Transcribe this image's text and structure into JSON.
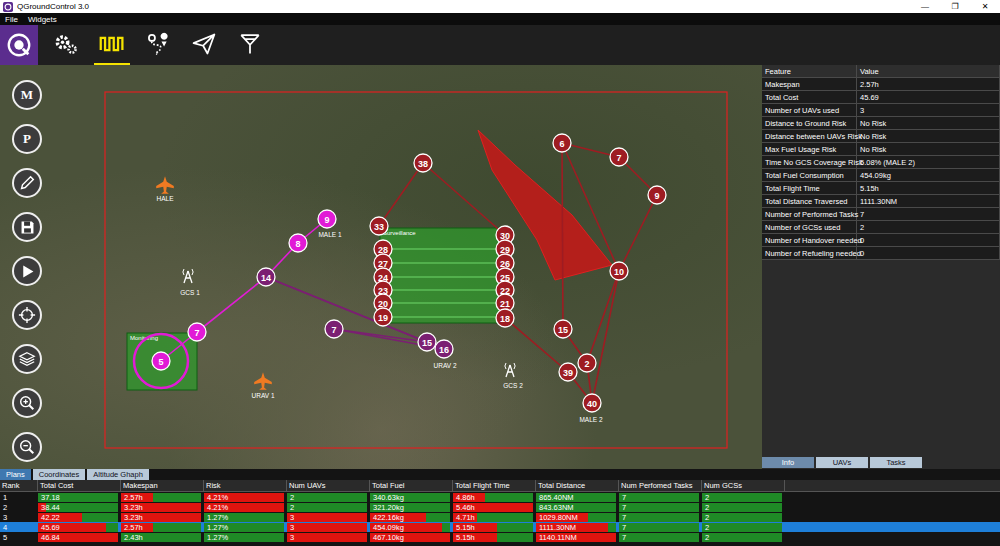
{
  "window": {
    "title": "QGroundControl 3.0",
    "controls": [
      "—",
      "❐",
      "✕"
    ]
  },
  "menu": [
    "File",
    "Widgets"
  ],
  "toolbar": {
    "tools": [
      {
        "kind": "settings",
        "selected": false
      },
      {
        "kind": "analyze",
        "selected": true
      },
      {
        "kind": "plan",
        "selected": false
      },
      {
        "kind": "fly",
        "selected": false
      },
      {
        "kind": "antenna",
        "selected": false
      }
    ]
  },
  "map_buttons": [
    {
      "kind": "letter",
      "label": "M"
    },
    {
      "kind": "letter",
      "label": "P"
    },
    {
      "kind": "edit",
      "label": ""
    },
    {
      "kind": "save",
      "label": ""
    },
    {
      "kind": "play",
      "label": ""
    },
    {
      "kind": "target",
      "label": ""
    },
    {
      "kind": "layers",
      "label": ""
    },
    {
      "kind": "zoom-in",
      "label": ""
    },
    {
      "kind": "zoom-out",
      "label": ""
    }
  ],
  "map": {
    "nodes": [
      {
        "label": "38",
        "color": "#9e1c22"
      },
      {
        "label": "33",
        "color": "#9e1c22"
      },
      {
        "label": "28",
        "color": "#9e1c22"
      },
      {
        "label": "27",
        "color": "#9e1c22"
      },
      {
        "label": "24",
        "color": "#9e1c22"
      },
      {
        "label": "23",
        "color": "#9e1c22"
      },
      {
        "label": "20",
        "color": "#9e1c22"
      },
      {
        "label": "19",
        "color": "#9e1c22"
      },
      {
        "label": "30",
        "color": "#9e1c22"
      },
      {
        "label": "29",
        "color": "#9e1c22"
      },
      {
        "label": "26",
        "color": "#9e1c22"
      },
      {
        "label": "25",
        "color": "#9e1c22"
      },
      {
        "label": "22",
        "color": "#9e1c22"
      },
      {
        "label": "21",
        "color": "#9e1c22"
      },
      {
        "label": "18",
        "color": "#9e1c22"
      },
      {
        "label": "6",
        "color": "#9e1c22"
      },
      {
        "label": "7",
        "color": "#9e1c22"
      },
      {
        "label": "9",
        "color": "#9e1c22"
      },
      {
        "label": "10",
        "color": "#9e1c22"
      },
      {
        "label": "15",
        "color": "#9e1c22"
      },
      {
        "label": "2",
        "color": "#9e1c22"
      },
      {
        "label": "39",
        "color": "#9e1c22"
      },
      {
        "label": "40",
        "color": "#9e1c22"
      },
      {
        "label": "9",
        "color": "#e11bd6"
      },
      {
        "label": "8",
        "color": "#e11bd6"
      },
      {
        "label": "14",
        "color": "#7b1f72"
      },
      {
        "label": "7",
        "color": "#e11bd6"
      },
      {
        "label": "5",
        "color": "#e11bd6"
      },
      {
        "label": "7",
        "color": "#7b1f72"
      },
      {
        "label": "15",
        "color": "#7b1f72"
      },
      {
        "label": "16",
        "color": "#7b1f72"
      }
    ],
    "markers": [
      {
        "label": "HALE",
        "kind": "plane"
      },
      {
        "label": "GCS 1",
        "kind": "antenna"
      },
      {
        "label": "URAV 1",
        "kind": "plane"
      },
      {
        "label": "GCS 2",
        "kind": "antenna"
      },
      {
        "label": "MALE 1",
        "kind": "tag"
      },
      {
        "label": "URAV 2",
        "kind": "tag"
      },
      {
        "label": "MALE 2",
        "kind": "tag"
      }
    ],
    "areas": [
      {
        "label": "Surveillance"
      },
      {
        "label": "Monitoring"
      }
    ]
  },
  "info": {
    "columns": [
      "Feature",
      "Value"
    ],
    "rows": [
      {
        "feature": "Makespan",
        "value": "2.57h"
      },
      {
        "feature": "Total Cost",
        "value": "45.69"
      },
      {
        "feature": "Number of UAVs used",
        "value": "3"
      },
      {
        "feature": "Distance to Ground Risk",
        "value": "No Risk"
      },
      {
        "feature": "Distance between UAVs Risk",
        "value": "No Risk"
      },
      {
        "feature": "Max Fuel Usage Risk",
        "value": "No Risk"
      },
      {
        "feature": "Time No GCS Coverage Risk",
        "value": "5.08% (MALE 2)"
      },
      {
        "feature": "Total Fuel Consumption",
        "value": "454.09kg"
      },
      {
        "feature": "Total Flight Time",
        "value": "5.15h"
      },
      {
        "feature": "Total Distance Traversed",
        "value": "1111.30NM"
      },
      {
        "feature": "Number of Performed Tasks",
        "value": "7"
      },
      {
        "feature": "Number of GCSs used",
        "value": "2"
      },
      {
        "feature": "Number of Handover needed",
        "value": "0"
      },
      {
        "feature": "Number of Refueling needed",
        "value": "0"
      }
    ],
    "tabs": [
      {
        "label": "Info",
        "selected": true
      },
      {
        "label": "UAVs",
        "selected": false
      },
      {
        "label": "Tasks",
        "selected": false
      }
    ]
  },
  "plans": {
    "tabs": [
      {
        "label": "Plans",
        "selected": true
      },
      {
        "label": "Coordinates",
        "selected": false
      },
      {
        "label": "Altitude Ghaph",
        "selected": false
      }
    ],
    "columns": [
      "Rank",
      "Total Cost",
      "Makespan",
      "Risk",
      "Num UAVs",
      "Total Fuel",
      "Total Flight Time",
      "Total Distance",
      "Num Perfomed Tasks",
      "Num GCSs"
    ],
    "rows": [
      {
        "rank": "1",
        "selected": false,
        "cells": [
          {
            "text": "37.18",
            "level": 0
          },
          {
            "text": "2.57h",
            "level": 0.4
          },
          {
            "text": "4.21%",
            "level": 1
          },
          {
            "text": "2",
            "level": 0
          },
          {
            "text": "340.63kg",
            "level": 0
          },
          {
            "text": "4.86h",
            "level": 0.4
          },
          {
            "text": "865.40NM",
            "level": 0
          },
          {
            "text": "7",
            "level": 0
          },
          {
            "text": "2",
            "level": 0
          }
        ]
      },
      {
        "rank": "2",
        "selected": false,
        "cells": [
          {
            "text": "38.44",
            "level": 0.1
          },
          {
            "text": "3.23h",
            "level": 1
          },
          {
            "text": "4.21%",
            "level": 1
          },
          {
            "text": "2",
            "level": 0
          },
          {
            "text": "321.20kg",
            "level": 0
          },
          {
            "text": "5.46h",
            "level": 1
          },
          {
            "text": "843.63NM",
            "level": 0
          },
          {
            "text": "7",
            "level": 0
          },
          {
            "text": "2",
            "level": 0
          }
        ]
      },
      {
        "rank": "3",
        "selected": false,
        "cells": [
          {
            "text": "42.22",
            "level": 0.55
          },
          {
            "text": "3.23h",
            "level": 1
          },
          {
            "text": "1.27%",
            "level": 0
          },
          {
            "text": "3",
            "level": 1
          },
          {
            "text": "422.16kg",
            "level": 0.7
          },
          {
            "text": "4.71h",
            "level": 0.3
          },
          {
            "text": "1029.80NM",
            "level": 0.65
          },
          {
            "text": "7",
            "level": 0
          },
          {
            "text": "2",
            "level": 0
          }
        ]
      },
      {
        "rank": "4",
        "selected": true,
        "cells": [
          {
            "text": "45.69",
            "level": 0.85
          },
          {
            "text": "2.57h",
            "level": 0.4
          },
          {
            "text": "1.27%",
            "level": 0
          },
          {
            "text": "3",
            "level": 1
          },
          {
            "text": "454.09kg",
            "level": 0.9
          },
          {
            "text": "5.15h",
            "level": 0.55
          },
          {
            "text": "1111.30NM",
            "level": 0.9
          },
          {
            "text": "7",
            "level": 0
          },
          {
            "text": "2",
            "level": 0
          }
        ]
      },
      {
        "rank": "5",
        "selected": false,
        "cells": [
          {
            "text": "46.84",
            "level": 1
          },
          {
            "text": "2.43h",
            "level": 0
          },
          {
            "text": "1.27%",
            "level": 0
          },
          {
            "text": "3",
            "level": 1
          },
          {
            "text": "467.10kg",
            "level": 1
          },
          {
            "text": "5.15h",
            "level": 0.55
          },
          {
            "text": "1140.11NM",
            "level": 1
          },
          {
            "text": "7",
            "level": 0
          },
          {
            "text": "2",
            "level": 0
          }
        ]
      }
    ]
  }
}
